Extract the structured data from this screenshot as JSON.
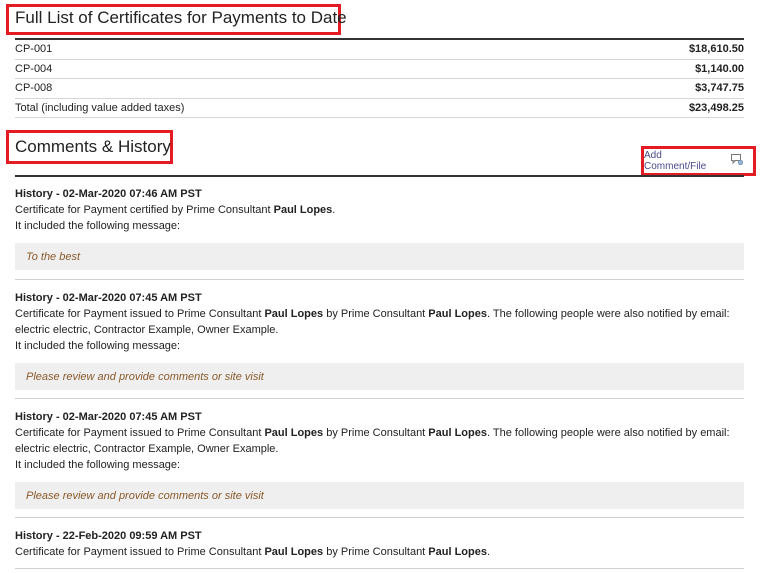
{
  "certificates": {
    "heading": "Full List of Certificates for Payments to Date",
    "rows": [
      {
        "id": "CP-001",
        "amount": "$18,610.50"
      },
      {
        "id": "CP-004",
        "amount": "$1,140.00"
      },
      {
        "id": "CP-008",
        "amount": "$3,747.75"
      }
    ],
    "total_label": "Total (including value added taxes)",
    "total_amount": "$23,498.25"
  },
  "comments": {
    "heading": "Comments & History",
    "add_button_label": "Add Comment/File",
    "entries": [
      {
        "title": "History - 02-Mar-2020 07:46 AM PST",
        "text_a": "Certificate for Payment certified by Prime Consultant ",
        "name_a": "Paul Lopes",
        "text_b": ".",
        "intro": "It included the following message:",
        "message": "To the best"
      },
      {
        "title": "History - 02-Mar-2020 07:45 AM PST",
        "text_a": "Certificate for Payment issued to Prime Consultant ",
        "name_a": "Paul Lopes",
        "text_b": " by Prime Consultant ",
        "name_b": "Paul Lopes",
        "text_c": ". The following people were also notified by email: electric electric, Contractor Example, Owner Example.",
        "intro": "It included the following message:",
        "message": "Please review and provide comments or site visit"
      },
      {
        "title": "History - 02-Mar-2020 07:45 AM PST",
        "text_a": "Certificate for Payment issued to Prime Consultant ",
        "name_a": "Paul Lopes",
        "text_b": " by Prime Consultant ",
        "name_b": "Paul Lopes",
        "text_c": ". The following people were also notified by email: electric electric, Contractor Example, Owner Example.",
        "intro": "It included the following message:",
        "message": "Please review and provide comments or site visit"
      },
      {
        "title": "History - 22-Feb-2020 09:59 AM PST",
        "text_a": "Certificate for Payment issued to Prime Consultant ",
        "name_a": "Paul Lopes",
        "text_b": " by Prime Consultant ",
        "name_b": "Paul Lopes",
        "text_c": "."
      }
    ]
  },
  "colors": {
    "highlight": "#e41b23",
    "message_text": "#8a5a2b",
    "message_bg": "#efefef"
  },
  "icons": {
    "add_comment": "comment-add-icon"
  }
}
